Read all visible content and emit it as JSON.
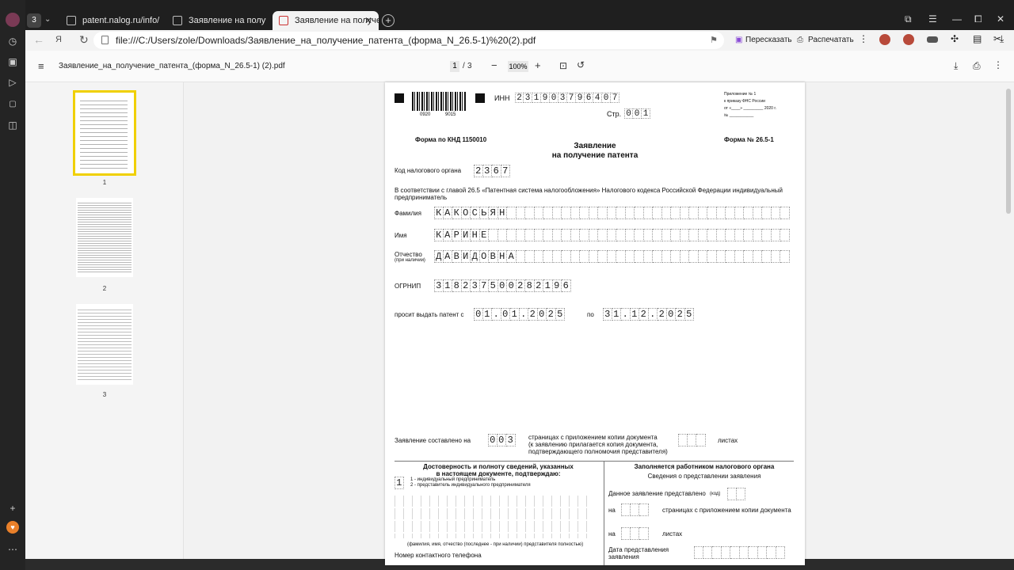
{
  "browser": {
    "tab_count_badge": "3",
    "tabs": [
      {
        "label": "patent.nalog.ru/info/"
      },
      {
        "label": "Заявление на получение"
      },
      {
        "label": "Заявление на получение"
      }
    ],
    "url": "file:///C:/Users/zole/Downloads/Заявление_на_получение_патента_(форма_N_26.5-1)%20(2).pdf",
    "retell_label": "Пересказать",
    "print_label": "Распечатать"
  },
  "viewer": {
    "doc_title": "Заявление_на_получение_патента_(форма_N_26.5-1) (2).pdf",
    "current_page": "1",
    "page_sep": "/",
    "total_pages": "3",
    "zoom": "100%",
    "thumbnails": [
      "1",
      "2",
      "3"
    ]
  },
  "form": {
    "barcode_nums": [
      "0920",
      "9015"
    ],
    "inn_label": "ИНН",
    "inn": "231903796407",
    "page_label": "Стр.",
    "page_no": "001",
    "appendix": [
      "Приложение № 1",
      "к приказу ФНС России",
      "от «____» _________ 2020 г.",
      "№ ___________"
    ],
    "knd": "Форма по КНД 1150010",
    "title1": "Заявление",
    "title2": "на получение патента",
    "form_no": "Форма № 26.5-1",
    "tax_code_label": "Код налогового органа",
    "tax_code": "2367",
    "intro1": "В соответствии с главой 26.5 «Патентная система налогообложения» Налогового кодекса Российской Федерации индивидуальный",
    "intro2": "предприниматель",
    "surname_label": "Фамилия",
    "surname": "КАКОСЬЯН",
    "name_label": "Имя",
    "name": "КАРИНЕ",
    "patronymic_label": "Отчество",
    "patronymic_note": "(при наличии)",
    "patronymic": "ДАВИДОВНА",
    "ogrnip_label": "ОГРНИП",
    "ogrnip": "318237500282196",
    "request_label": "просит выдать патент с",
    "date_from": "01.01.2025",
    "to_label": "по",
    "date_to": "31.12.2025",
    "composed_label": "Заявление составлено на",
    "pages_count": "003",
    "pages_text1": "страницах с приложением копии документа",
    "pages_text2": "(к заявлению прилагается копия документа,",
    "pages_text3": "подтверждающего полномочия представителя)",
    "sheets_label": "листах",
    "confirm_title1": "Достоверность и полноту сведений, указанных",
    "confirm_title2": "в настоящем документе, подтверждаю:",
    "confirm_code": "1",
    "confirm_opt1": "1 - индивидуальный предприниматель",
    "confirm_opt2": "2 - представитель индивидуального предпринимателя",
    "fio_note": "(фамилия, имя, отчество (последнее - при наличии) представителя полностью)",
    "phone_label": "Номер контактного телефона",
    "officer_title": "Заполняется работником налогового органа",
    "officer_sub": "Сведения о представлении заявления",
    "submitted_label": "Данное заявление представлено",
    "code_note": "(код)",
    "on_label": "на",
    "officer_pages_text": "страницах с приложением копии документа",
    "on_label2": "на",
    "officer_sheets": "листах",
    "date_label1": "Дата представления",
    "date_label2": "заявления"
  }
}
